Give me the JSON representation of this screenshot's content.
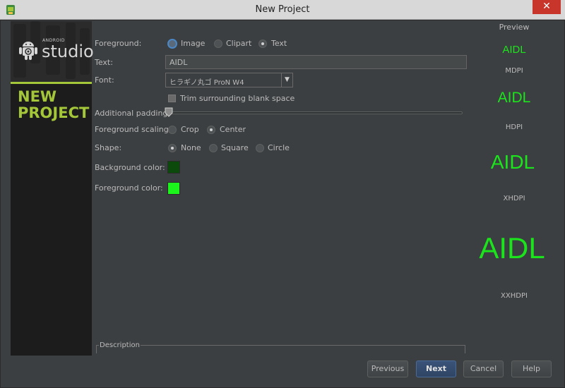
{
  "window": {
    "title": "New Project",
    "close_glyph": "✕"
  },
  "banner": {
    "android_label": "ANDROID",
    "studio_label": "studio",
    "heading_line1": "NEW",
    "heading_line2": "PROJECT"
  },
  "form": {
    "foreground_label": "Foreground:",
    "foreground_options": [
      "Image",
      "Clipart",
      "Text"
    ],
    "text_label": "Text:",
    "text_value": "AIDL",
    "font_label": "Font:",
    "font_value": "ヒラギノ丸ゴ ProN W4",
    "trim_label": "Trim surrounding blank space",
    "padding_label": "Additional padding:",
    "padding_value": 0,
    "scaling_label": "Foreground scaling:",
    "scaling_options": [
      "Crop",
      "Center"
    ],
    "shape_label": "Shape:",
    "shape_options": [
      "None",
      "Square",
      "Circle"
    ],
    "bg_color_label": "Background color:",
    "bg_color": "#0b4a0b",
    "fg_color_label": "Foreground color:",
    "fg_color": "#1cf51c",
    "description_label": "Description"
  },
  "preview": {
    "title": "Preview",
    "items": [
      {
        "text": "AIDL",
        "density": "MDPI"
      },
      {
        "text": "AIDL",
        "density": "HDPI"
      },
      {
        "text": "AIDL",
        "density": "XHDPI"
      },
      {
        "text": "AIDL",
        "density": "XXHDPI"
      }
    ]
  },
  "buttons": {
    "previous": "Previous",
    "next": "Next",
    "cancel": "Cancel",
    "help": "Help"
  }
}
